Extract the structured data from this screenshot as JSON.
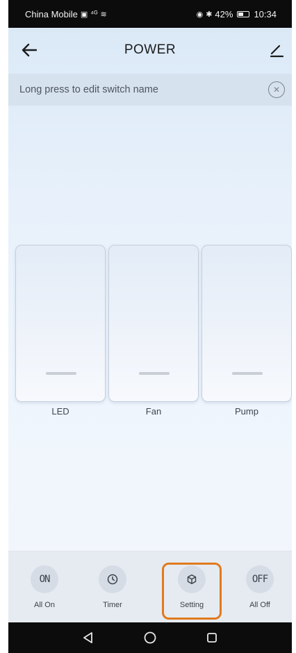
{
  "status_bar": {
    "carrier": "China Mobile",
    "signal": "⁴ᴳ",
    "wifi": "≋",
    "battery_percent": "42%",
    "time": "10:34"
  },
  "header": {
    "title": "POWER",
    "back_icon": "arrow-left-icon",
    "edit_icon": "pencil-icon"
  },
  "hint": {
    "text": "Long press to edit switch name",
    "close_icon": "close-circle-icon"
  },
  "switches": [
    {
      "label": "LED"
    },
    {
      "label": "Fan"
    },
    {
      "label": "Pump"
    }
  ],
  "actions": [
    {
      "label": "All On",
      "icon_text": "ON"
    },
    {
      "label": "Timer",
      "icon": "clock-icon"
    },
    {
      "label": "Setting",
      "icon": "cube-icon",
      "highlighted": true,
      "highlight_color": "#e07a1f"
    },
    {
      "label": "All Off",
      "icon_text": "OFF"
    }
  ],
  "nav": {
    "back": "triangle-back-icon",
    "home": "circle-home-icon",
    "recent": "square-recent-icon"
  }
}
